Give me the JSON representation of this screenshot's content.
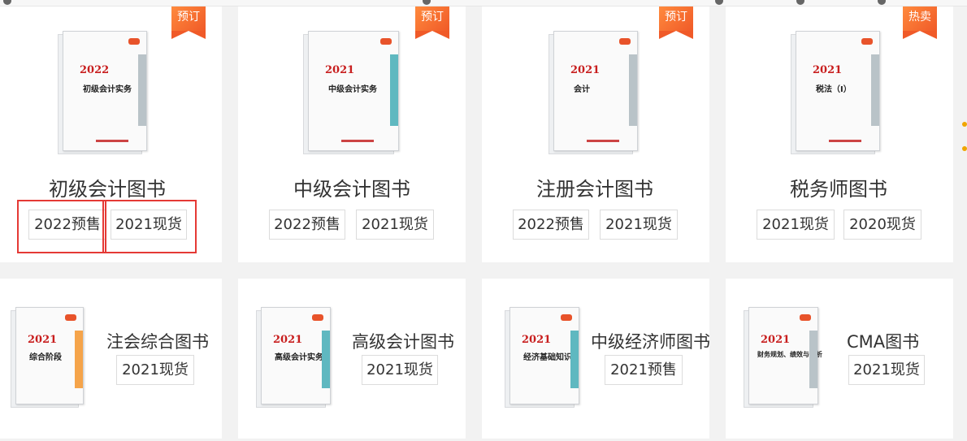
{
  "cards_top": [
    {
      "category": "初级会计图书",
      "badge": "预订",
      "tags": [
        "2022预售",
        "2021现货"
      ],
      "cover_year": "2022",
      "cover_title": "初级会计实务"
    },
    {
      "category": "中级会计图书",
      "badge": "预订",
      "tags": [
        "2022预售",
        "2021现货"
      ],
      "cover_year": "2021",
      "cover_title": "中级会计实务"
    },
    {
      "category": "注册会计图书",
      "badge": "预订",
      "tags": [
        "2022预售",
        "2021现货"
      ],
      "cover_year": "2021",
      "cover_title": "会计"
    },
    {
      "category": "税务师图书",
      "badge": "热卖",
      "tags": [
        "2021现货",
        "2020现货"
      ],
      "cover_year": "2021",
      "cover_title": "税法（Ⅰ）"
    }
  ],
  "cards_bottom": [
    {
      "category": "注会综合图书",
      "tags": [
        "2021现货"
      ],
      "cover_year": "2021",
      "cover_title": "综合阶段"
    },
    {
      "category": "高级会计图书",
      "tags": [
        "2021现货"
      ],
      "cover_year": "2021",
      "cover_title": "高级会计实务"
    },
    {
      "category": "中级经济师图书",
      "tags": [
        "2021预售"
      ],
      "cover_year": "2021",
      "cover_title": "经济基础知识"
    },
    {
      "category": "CMA图书",
      "tags": [
        "2021现货"
      ],
      "cover_year": "2021",
      "cover_title": "财务规划、绩效与分析"
    }
  ],
  "colors": {
    "badge": "#f05a28",
    "highlight": "#e53935",
    "card_bg": "#ffffff",
    "page_bg": "#f2f2f2"
  }
}
